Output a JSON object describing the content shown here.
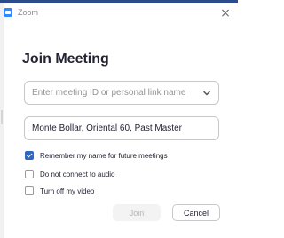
{
  "window": {
    "app_title": "Zoom",
    "app_icon": "zoom-video-icon",
    "close_icon": "close-icon",
    "close_symbol": "×",
    "accent_color": "#2d8cff"
  },
  "dialog": {
    "heading": "Join Meeting",
    "meeting_id_field": {
      "value": "",
      "placeholder": "Enter meeting ID or personal link name",
      "dropdown_icon": "chevron-down-icon"
    },
    "name_field": {
      "value": "Monte Bollar, Oriental 60, Past Master",
      "placeholder": ""
    },
    "options": [
      {
        "label": "Remember my name for future meetings",
        "checked": true
      },
      {
        "label": "Do not connect to audio",
        "checked": false
      },
      {
        "label": "Turn off my video",
        "checked": false
      }
    ],
    "buttons": {
      "join_label": "Join",
      "join_enabled": false,
      "cancel_label": "Cancel"
    }
  }
}
